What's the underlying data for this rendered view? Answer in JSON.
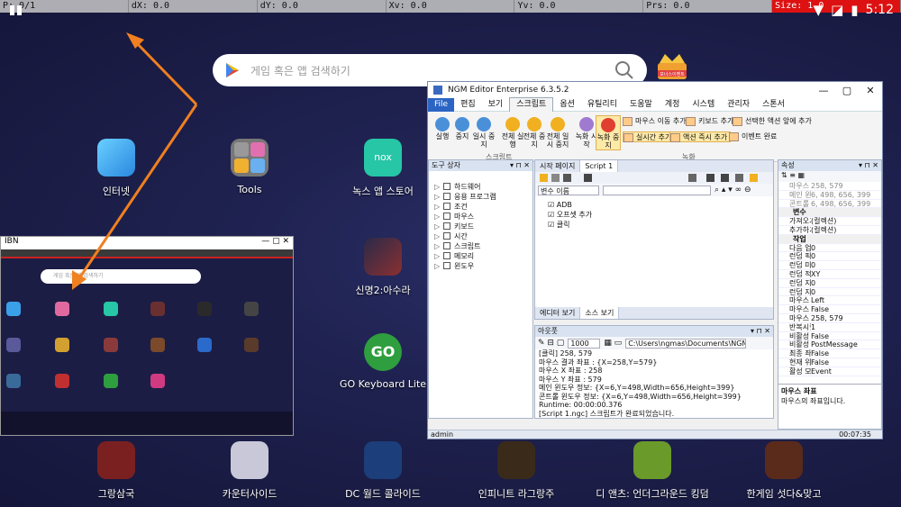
{
  "devbar": {
    "p": "P: 0/1",
    "dx": "dX: 0.0",
    "dy": "dY: 0.0",
    "xv": "Xv: 0.0",
    "yv": "Yv: 0.0",
    "prs": "Prs: 0.0",
    "size": "Size: 1.0"
  },
  "status": {
    "time": "5:12"
  },
  "search": {
    "placeholder": "게임 혹은 앱 검색하기"
  },
  "game_badge": {
    "text": "보너스이벤트"
  },
  "apps_top": [
    {
      "label": "인터넷",
      "color": "#3aa0e8"
    },
    {
      "label": "Tools",
      "color": "#8a8a8a"
    },
    {
      "label": "녹스 앱 스토어",
      "color": "#26c6a6"
    },
    {
      "label": "신명2:아수라",
      "color": "#6a3030"
    },
    {
      "label": "GO Keyboard Lite",
      "color": "#2e9e3e"
    }
  ],
  "dock": [
    {
      "label": "그랑삼국",
      "color": "#7a2020"
    },
    {
      "label": "카운터사이드",
      "color": "#c8c8d8"
    },
    {
      "label": "DC 월드 콜라이드",
      "color": "#1c3e7a"
    },
    {
      "label": "인피니트 라그랑주",
      "color": "#3a2a1a"
    },
    {
      "label": "디 앤츠: 언더그라운드 킹덤",
      "color": "#6a9a2a"
    },
    {
      "label": "한게임 섯다&맞고",
      "color": "#5a2a1a"
    }
  ],
  "mirror": {
    "title": "IBN",
    "search_placeholder": "게임 혹은 앱 검색하기",
    "icon_colors": [
      "#3aa0e8",
      "#e06aa0",
      "#26c6a6",
      "#6a3030",
      "#2a2a2a",
      "#444",
      "#5a5a9a",
      "#d2a030",
      "#8a3a3a",
      "#7a4a2a",
      "#2a6aca",
      "#5a3a2a",
      "#3a6a9a",
      "#c03030",
      "#2e9e3e",
      "#d03a80"
    ]
  },
  "editor": {
    "title": "NGM Editor   Enterprise 6.3.5.2",
    "menu": [
      "File",
      "편집",
      "보기",
      "스크립트",
      "옵션",
      "유틸리티",
      "도움말",
      "계정",
      "시스템",
      "관리자",
      "스톤서"
    ],
    "ribbon_buttons": [
      {
        "label": "실행",
        "color": "#4a90d9"
      },
      {
        "label": "중지",
        "color": "#4a90d9"
      },
      {
        "label": "일시 중지",
        "color": "#4a90d9"
      },
      {
        "label": "전체 실행",
        "color": "#f0b020"
      },
      {
        "label": "전체 중지",
        "color": "#f0b020"
      },
      {
        "label": "전체 일시 중지",
        "color": "#f0b020"
      },
      {
        "label": "녹화 시작",
        "color": "#a07ad0"
      },
      {
        "label": "녹화 중지",
        "color": "#e04030"
      }
    ],
    "ribbon_small": [
      "마우스 이동 추가",
      "키보드 추가",
      "선택한 액션 앞에 추가",
      "실시간 추가",
      "액션 즉시 추가",
      "이벤트 완료"
    ],
    "groups": [
      "스크립트",
      "녹화"
    ],
    "toolbox": {
      "title": "도구 상자",
      "items": [
        "하드웨어",
        "응용 프로그램",
        "조건",
        "마우스",
        "키보드",
        "시간",
        "스크립트",
        "메모리",
        "윈도우"
      ]
    },
    "tabs": [
      "시작 페이지",
      "Script 1"
    ],
    "var_name": "변수 이름",
    "script_nodes": [
      "ADB",
      "오프셋 추가",
      "클릭"
    ],
    "editor_tabs": [
      "에디터 보기",
      "소스 보기"
    ],
    "output": {
      "title": "아웃풋",
      "count": "1000",
      "path": "C:\\Users\\ngmas\\Documents\\NGM\\",
      "lines": [
        "[클릭] 258, 579",
        "마우스 결과 좌표 : {X=258,Y=579}",
        "마우스 X 좌표 : 258",
        "마우스 Y 좌표 : 579",
        "메인 윈도우 정보: {X=6,Y=498,Width=656,Height=399}",
        "콘트롤 윈도우 정보: {X=6,Y=498,Width=656,Height=399}",
        "Runtime: 00:00:00.376",
        "[Script 1.ngc] 스크립트가 완료되었습니다."
      ]
    },
    "props": {
      "title": "속성",
      "rows": [
        {
          "k": "마우스 좌",
          "v": "258, 579",
          "gray": true
        },
        {
          "k": "메인 윈도",
          "v": "6, 498, 656, 399",
          "gray": true
        },
        {
          "k": "콘트롤 윈",
          "v": "6, 498, 656, 399",
          "gray": true
        },
        {
          "k": "변수",
          "v": "",
          "sec": true
        },
        {
          "k": "가져오기",
          "v": "(컬렉션)"
        },
        {
          "k": "추가하기",
          "v": "(컬렉션)"
        },
        {
          "k": "작업",
          "v": "",
          "sec": true
        },
        {
          "k": "다음 업 지",
          "v": "0"
        },
        {
          "k": "런덤 픽사",
          "v": "0"
        },
        {
          "k": "런덤 미니",
          "v": "0"
        },
        {
          "k": "런덤 적용",
          "v": "XY"
        },
        {
          "k": "런덤 지연",
          "v": "0"
        },
        {
          "k": "런덤 지연",
          "v": "0"
        },
        {
          "k": "마우스 동",
          "v": "Left"
        },
        {
          "k": "마우스 이",
          "v": "False"
        },
        {
          "k": "마우스 좌",
          "v": "258, 579"
        },
        {
          "k": "반복시킬",
          "v": "1"
        },
        {
          "k": "비활성 모",
          "v": "False"
        },
        {
          "k": "비활성 모",
          "v": "PostMessage"
        },
        {
          "k": "최종 좌표",
          "v": "False"
        },
        {
          "k": "현재 위치",
          "v": "False"
        },
        {
          "k": "활성 모드",
          "v": "Event"
        }
      ],
      "desc_title": "마우스 좌표",
      "desc": "마우스의 좌표입니다."
    },
    "status_user": "admin",
    "status_time": "00:07:35"
  }
}
